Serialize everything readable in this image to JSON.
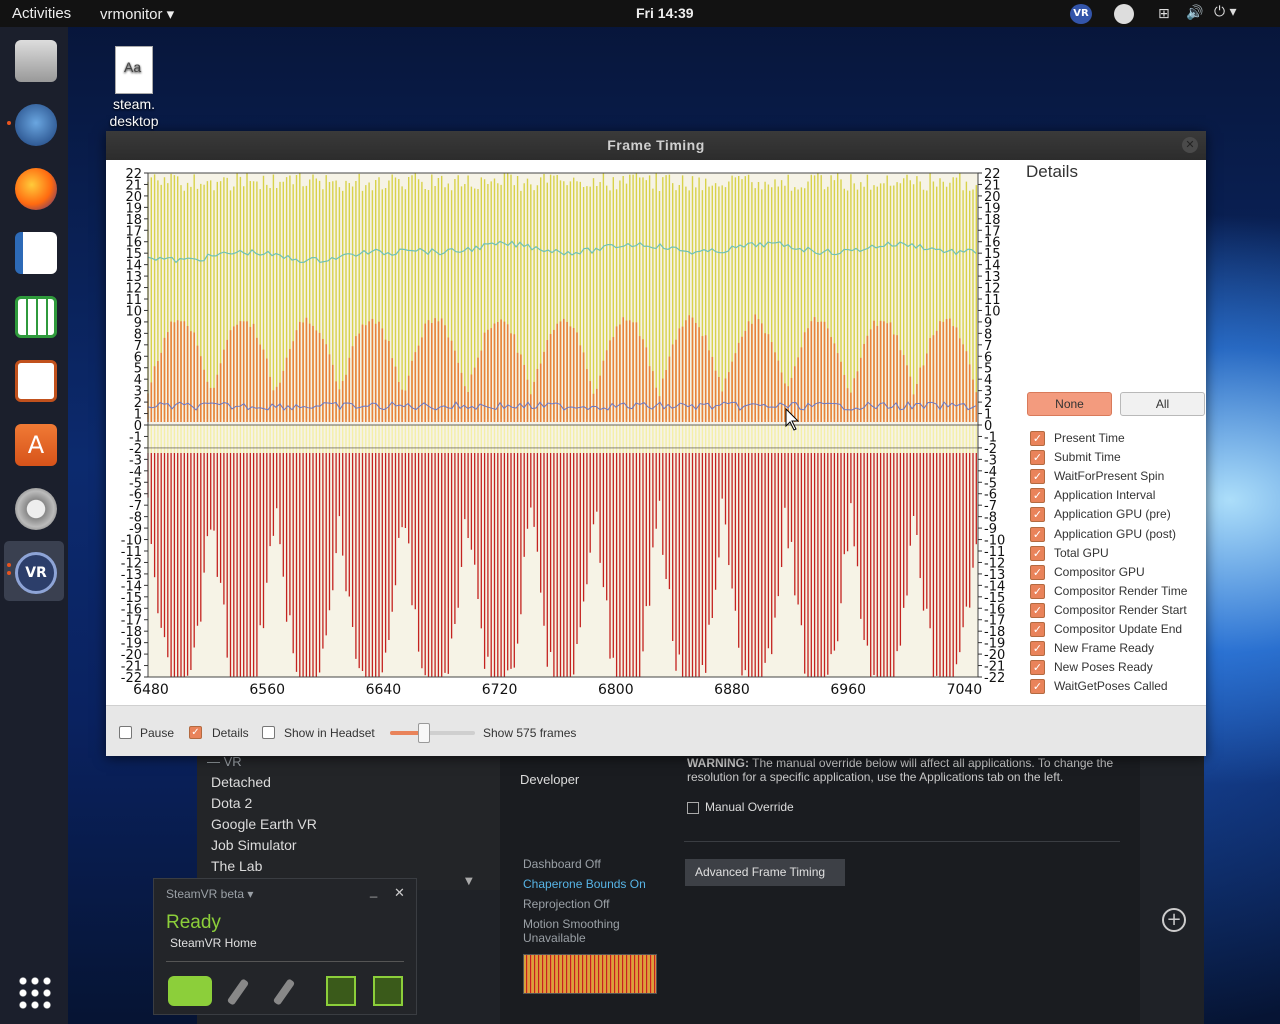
{
  "topbar": {
    "activities": "Activities",
    "app_menu": "vrmonitor ▾",
    "clock": "Fri 14:39",
    "tray_icons": [
      "vr-icon",
      "steam-icon",
      "network-icon",
      "volume-icon",
      "power-icon"
    ]
  },
  "dock": {
    "items": [
      "files-icon",
      "steam-icon",
      "firefox-icon",
      "writer-icon",
      "calc-icon",
      "impress-icon",
      "software-icon",
      "settings-icon",
      "steamvr-icon",
      "app-grid-icon"
    ]
  },
  "desktop_icon": {
    "line1": "steam.",
    "line2": "desktop",
    "glyph": "Aa"
  },
  "frame_timing": {
    "title": "Frame Timing",
    "details_title": "Details",
    "none_label": "None",
    "all_label": "All",
    "y_ticks": [
      "22",
      "21",
      "20",
      "19",
      "18",
      "17",
      "16",
      "15",
      "14",
      "13",
      "12",
      "11",
      "10",
      "9",
      "8",
      "7",
      "6",
      "5",
      "4",
      "3",
      "2",
      "1",
      "0",
      "-1",
      "-2",
      "-3",
      "-4",
      "-5",
      "-6",
      "-7",
      "-8",
      "-9",
      "-10",
      "-11",
      "-12",
      "-13",
      "-14",
      "-15",
      "-16",
      "-17",
      "-18",
      "-19",
      "-20",
      "-21",
      "-22"
    ],
    "x_ticks": [
      "6480",
      "6560",
      "6640",
      "6720",
      "6800",
      "6880",
      "6960",
      "7040"
    ],
    "series": [
      {
        "label": "Present Time",
        "checked": true
      },
      {
        "label": "Submit Time",
        "checked": true
      },
      {
        "label": "WaitForPresent Spin",
        "checked": true
      },
      {
        "label": "Application Interval",
        "checked": true
      },
      {
        "label": "Application GPU (pre)",
        "checked": true
      },
      {
        "label": "Application GPU (post)",
        "checked": true
      },
      {
        "label": "Total GPU",
        "checked": true
      },
      {
        "label": "Compositor GPU",
        "checked": true
      },
      {
        "label": "Compositor Render Time",
        "checked": true
      },
      {
        "label": "Compositor Render Start",
        "checked": true
      },
      {
        "label": "Compositor Update End",
        "checked": true
      },
      {
        "label": "New Frame Ready",
        "checked": true
      },
      {
        "label": "New Poses Ready",
        "checked": true
      },
      {
        "label": "WaitGetPoses Called",
        "checked": true
      }
    ],
    "footer": {
      "pause_label": "Pause",
      "details_label": "Details",
      "headset_label": "Show in Headset",
      "frames_label": "Show 575 frames",
      "slider_value": 0.4
    },
    "colors": {
      "yellow": "#d8d24a",
      "orange": "#e8823a",
      "red": "#c4221f",
      "cream": "#f4efa8",
      "teal": "#6fc1b6",
      "blue": "#6a78c4"
    }
  },
  "background_window": {
    "group_label": "VR",
    "games": [
      "Detached",
      "Dota 2",
      "Google Earth VR",
      "Job Simulator",
      "The Lab"
    ],
    "nav_developer": "Developer",
    "warning_bold": "WARNING:",
    "warning_text": "The manual override below will affect all applications. To change the resolution for a specific application, use the Applications tab on the left.",
    "manual_override": "Manual Override",
    "advanced_button": "Advanced Frame Timing",
    "status": [
      "Dashboard Off",
      "Chaperone Bounds On",
      "Reprojection Off",
      "Motion Smoothing Unavailable"
    ]
  },
  "steamvr_status": {
    "title": "SteamVR beta ▾",
    "state": "Ready",
    "home": "SteamVR Home"
  }
}
